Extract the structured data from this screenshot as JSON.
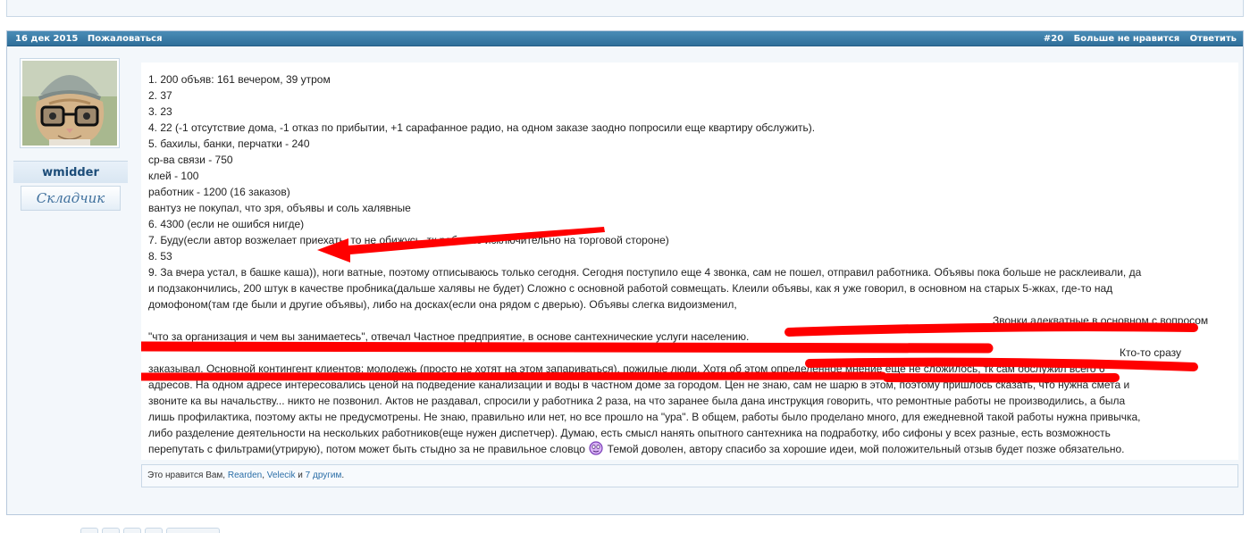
{
  "post": {
    "date": "16 дек 2015",
    "report_label": "Пожаловаться",
    "post_number": "#20",
    "unlike_label": "Больше не нравится",
    "reply_label": "Ответить",
    "author": {
      "username": "wmidder",
      "user_title": "Складчик",
      "avatar_icon": "cat-with-glasses-avatar-icon"
    },
    "lines": [
      "1. 200 объяв: 161 вечером, 39 утром",
      "2. 37",
      "3. 23",
      "4. 22 (-1 отсутствие дома, -1 отказ по прибытии, +1 сарафанное радио, на одном заказе заодно попросили еще квартиру обслужить).",
      "5. бахилы, банки, перчатки - 240",
      "ср-ва связи - 750",
      "клей - 100",
      "работник - 1200 (16 заказов)",
      "вантуз не покупал, что зря, объявы и соль халявные",
      "6. 4300 (если не ошибся нигде)",
      "7. Буду(если автор возжелает приехать, то не обижусь, тк работаю исключительно на торговой стороне)",
      "8. 53",
      "9. За вчера устал, в башке каша)), ноги ватные, поэтому отписываюсь только сегодня. Сегодня поступило еще 4 звонка, сам не пошел, отправил работника. Объявы пока больше не расклеивали, да",
      "и подзакончились, 200 штук в качестве пробника(дальше халявы не будет) Сложно с основной работой совмещать. Клеили объявы, как я уже говорил, в основном на старых 5-жках, где-то над",
      "домофоном(там где были и другие объявы), либо на досках(если она рядом с дверью). Объявы слегка видоизменил,",
      "Звонки адекватные в основном с вопросом",
      "\"что за организация и чем вы занимаетесь\", отвечал Частное предприятие, в основе сантехнические услуги населению.",
      "Кто-то сразу",
      "заказывал. Основной контингент клиентов: молодежь (просто не хотят на этом запариваться), пожилые люди. Хотя об этом определенное мнение еще не сложилось, тк сам обслужил всего 6",
      "адресов. На одном адресе интересовались ценой на подведение канализации и воды в частном доме за городом. Цен не знаю, сам не шарю в этом, поэтому пришлось сказать, что нужна смета и",
      "звоните ка вы начальству... никто не позвонил. Актов не раздавал, спросили у работника 2 раза, на что заранее была дана инструкция говорить, что ремонтные работы не производились, а была",
      "лишь профилактика, поэтому акты не предусмотрены. Не знаю, правильно или нет, но все прошло на \"ура\". В общем, работы было проделано много, для ежедневной такой работы нужна привычка,",
      "либо разделение деятельности на нескольких работников(еще нужен диспетчер). Думаю, есть смысл нанять опытного сантехника на подработку, ибо сифоны у всех разные, есть возможность",
      "перепутать с фильтрами(утрирую), потом может быть стыдно за не правильное словцо",
      "Темой доволен, автору спасибо за хорошие идеи, мой положительный отзыв будет позже обязательно."
    ],
    "likes": {
      "prefix": "Это нравится Вам,",
      "user1": "Rearden",
      "sep": ",",
      "user2": "Velecik",
      "and": "и",
      "others": "7 другим",
      "end": "."
    },
    "emoticon_icon": "embarrassed-smiley-icon",
    "annotation_color": "#ff0000"
  }
}
